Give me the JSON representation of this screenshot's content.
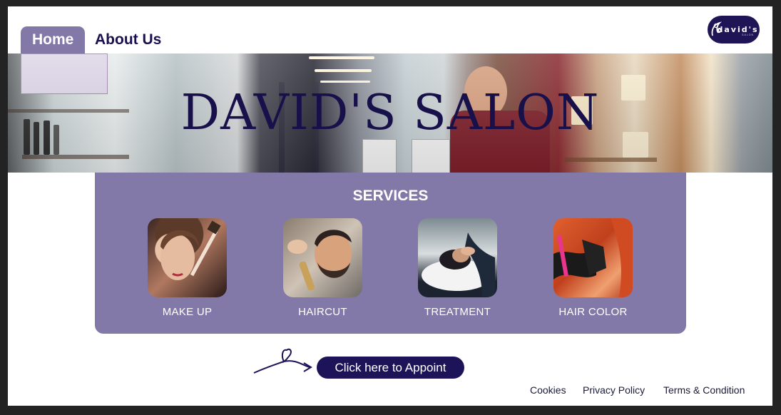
{
  "nav": {
    "home_label": "Home",
    "about_label": "About Us"
  },
  "logo": {
    "text": "david's",
    "subtext": "SALON"
  },
  "hero": {
    "title": "DAVID'S SALON"
  },
  "services": {
    "title": "SERVICES",
    "items": [
      {
        "label": "MAKE UP",
        "icon": "makeup-photo"
      },
      {
        "label": "HAIRCUT",
        "icon": "haircut-photo"
      },
      {
        "label": "TREATMENT",
        "icon": "treatment-photo"
      },
      {
        "label": "HAIR COLOR",
        "icon": "hair-color-photo"
      }
    ]
  },
  "appoint": {
    "label": "Click here to Appoint"
  },
  "footer": {
    "cookies": "Cookies",
    "privacy": "Privacy Policy",
    "terms": "Terms & Condition"
  },
  "colors": {
    "accent": "#8279a8",
    "brand_dark": "#1d1358",
    "title": "#18104a"
  }
}
